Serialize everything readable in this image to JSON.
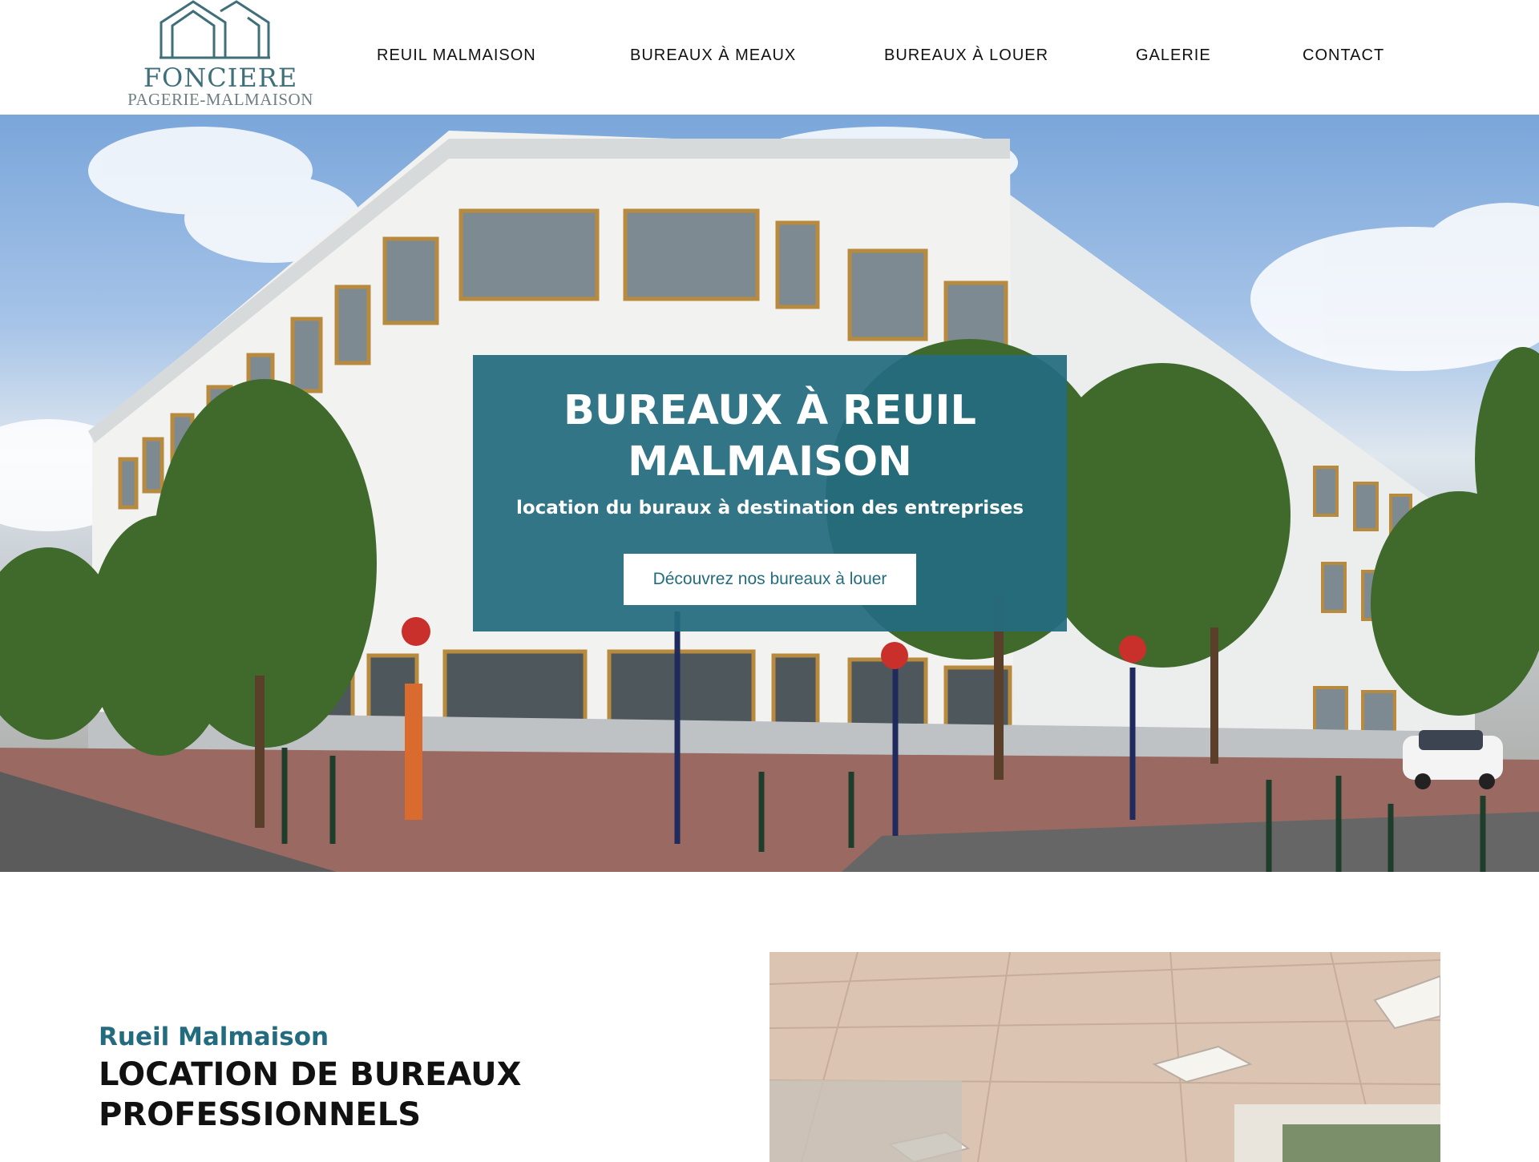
{
  "brand": {
    "name_line1": "FONCIERE",
    "name_line2": "PAGERIE-MALMAISON",
    "color": "#3f6f78"
  },
  "nav": {
    "items": [
      {
        "label": "REUIL MALMAISON"
      },
      {
        "label": "BUREAUX À MEAUX"
      },
      {
        "label": "BUREAUX À LOUER"
      },
      {
        "label": "GALERIE"
      },
      {
        "label": "CONTACT"
      }
    ]
  },
  "hero": {
    "title_line1": "BUREAUX À REUIL",
    "title_line2": "MALMAISON",
    "subtitle": "location du buraux à destination des entreprises",
    "cta_label": "Découvrez nos bureaux à louer",
    "overlay_color": "#236c7f",
    "image": "office-building-photo"
  },
  "intro": {
    "kicker": "Rueil Malmaison",
    "title_line1": "LOCATION DE BUREAUX",
    "title_line2": "PROFESSIONNELS",
    "image": "office-interior-photo"
  }
}
